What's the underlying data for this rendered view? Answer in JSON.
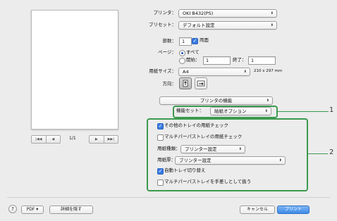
{
  "printer": {
    "label": "プリンタ：",
    "value": "OKI B432(PS)"
  },
  "preset": {
    "label": "プリセット：",
    "value": "デフォルト設定"
  },
  "copies": {
    "label": "部数：",
    "value": "1",
    "duplex_label": "両面",
    "duplex_checked": true
  },
  "pages": {
    "label": "ページ：",
    "all_label": "すべて",
    "range_start_label": "開始：",
    "range_start_value": "1",
    "range_end_label": "終了：",
    "range_end_value": "1"
  },
  "paper": {
    "label": "用紙サイズ：",
    "value": "A4",
    "dims": "210 x 297 mm"
  },
  "orientation": {
    "label": "方向："
  },
  "section_menu": {
    "value": "プリンタの機能"
  },
  "feature_set": {
    "label": "機能セット：",
    "value": "給紙オプション"
  },
  "options": {
    "tray_check": {
      "label": "その他のトレイの用紙チェック",
      "checked": true
    },
    "mp_tray_check": {
      "label": "マルチパーパストレイの用紙チェック",
      "checked": false
    },
    "paper_type": {
      "label": "用紙種類：",
      "value": "プリンター設定"
    },
    "paper_weight": {
      "label": "用紙厚：",
      "value": "プリンター設定"
    },
    "auto_tray_switch": {
      "label": "自動トレイ切り替え",
      "checked": true
    },
    "mp_manual": {
      "label": "マルチパーパストレイを手差しとして扱う",
      "checked": false
    }
  },
  "preview_nav": {
    "first": "|◀◀",
    "prev": "◀",
    "page": "1/1",
    "next": "▶",
    "last": "▶▶|"
  },
  "footer": {
    "help": "?",
    "pdf_label": "PDF ▾",
    "hide_details": "詳細を隠す",
    "cancel": "キャンセル",
    "print": "プリント"
  },
  "callouts": {
    "one": "1",
    "two": "2"
  },
  "colors": {
    "accent": "#3a7be3",
    "callout": "#3c9a4e"
  }
}
